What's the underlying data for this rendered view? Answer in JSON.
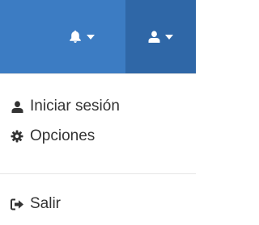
{
  "navbar": {
    "bg_color": "#3c7cc3",
    "active_bg_color": "#2f67a7",
    "notifications": {
      "icon": "bell-icon",
      "caret": "caret-down-icon"
    },
    "user": {
      "icon": "user-icon",
      "caret": "caret-down-icon"
    }
  },
  "dropdown": {
    "items": [
      {
        "label": "Iniciar sesión",
        "icon": "user-icon"
      },
      {
        "label": "Opciones",
        "icon": "gear-icon"
      },
      {
        "label": "Salir",
        "icon": "sign-out-icon"
      }
    ]
  }
}
